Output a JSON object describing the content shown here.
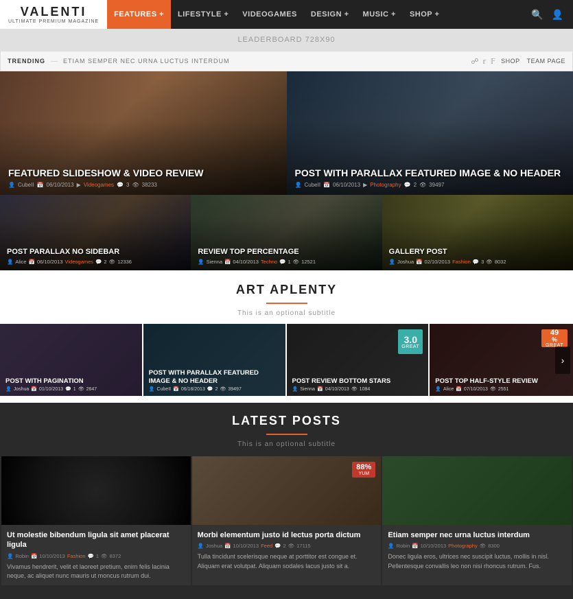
{
  "header": {
    "logo": "VALENTI",
    "logo_sub": "ULTIMATE PREMIUM MAGAZINE",
    "nav": [
      {
        "label": "FEATURES +",
        "active": true
      },
      {
        "label": "LIFESTYLE +",
        "active": false
      },
      {
        "label": "VIDEOGAMES",
        "active": false
      },
      {
        "label": "DESIGN +",
        "active": false
      },
      {
        "label": "MUSIC +",
        "active": false
      },
      {
        "label": "SHOP +",
        "active": false
      }
    ]
  },
  "leaderboard": "LEADERBOARD 728X90",
  "trending": {
    "label": "TRENDING",
    "text": "ETIAM SEMPER NEC URNA LUCTUS INTERDUM",
    "links": [
      "SHOP",
      "TEAM PAGE"
    ]
  },
  "featured": [
    {
      "title": "FEATURED SLIDESHOW & VIDEO REVIEW",
      "author": "CubeII",
      "date": "06/10/2013",
      "category": "Videogames",
      "comments": "3",
      "views": "38233"
    },
    {
      "title": "POST WITH PARALLAX FEATURED IMAGE & NO HEADER",
      "author": "CubeII",
      "date": "06/10/2013",
      "category": "Photography",
      "comments": "2",
      "views": "39497"
    }
  ],
  "small_posts": [
    {
      "title": "POST PARALLAX NO SIDEBAR",
      "author": "Alice",
      "date": "06/10/2013",
      "category": "Videogames",
      "comments": "2",
      "views": "12336"
    },
    {
      "title": "REVIEW TOP PERCENTAGE",
      "author": "Sienna",
      "date": "04/10/2013",
      "category": "Techno",
      "comments": "1",
      "views": "12521"
    },
    {
      "title": "GALLERY POST",
      "author": "Joshua",
      "date": "02/10/2013",
      "category": "Fashion",
      "comments": "3",
      "views": "8032"
    }
  ],
  "section1": {
    "title": "ART APLENTY",
    "subtitle": "This is an optional subtitle"
  },
  "carousel": [
    {
      "title": "POST WITH PAGINATION",
      "author": "Joshua",
      "date": "01/10/2013",
      "category": "",
      "comments": "1",
      "views": "2647",
      "score": null
    },
    {
      "title": "POST WITH PARALLAX FEATURED IMAGE & NO HEADER",
      "author": "CubeII",
      "date": "06/18/2013",
      "category": "",
      "comments": "2",
      "views": "39497",
      "score": null
    },
    {
      "title": "POST REVIEW BOTTOM STARS",
      "author": "Sienna",
      "date": "04/10/2013",
      "category": "",
      "comments": "",
      "views": "1084",
      "score": "3.0",
      "score_label": "GREAT"
    },
    {
      "title": "POST TOP HALF-STYLE REVIEW",
      "author": "Alice",
      "date": "07/10/2013",
      "category": "",
      "comments": "",
      "views": "2551",
      "score_pct": "49",
      "score_label": "GREAT"
    }
  ],
  "section2": {
    "title": "LATEST POSTS",
    "subtitle": "This is an optional subtitle"
  },
  "posts": [
    {
      "title": "Ut molestie bibendum ligula sit amet placerat ligula",
      "author": "Robin",
      "date": "10/10/2013",
      "category": "Fashion",
      "comments": "1",
      "views": "8372",
      "excerpt": "Vivamus hendrerit, velit et laoreet pretium, enim felis lacinia neque, ac aliquet nunc mauris ut moncus rutrum dui.",
      "score": null
    },
    {
      "title": "Morbi elementum justo id lectus porta dictum",
      "author": "Joshua",
      "date": "10/10/2013",
      "category": "Feed",
      "comments": "2",
      "views": "17115",
      "excerpt": "Tulla tincidunt scelerisque neque at porttitor est congue et. Aliquam erat volutpat. Aliquam sodales lacus justo sit a.",
      "score": "88",
      "score_label": "YUM"
    },
    {
      "title": "Etiam semper nec urna luctus interdum",
      "author": "Robin",
      "date": "10/10/2013",
      "category": "Photography",
      "comments": "",
      "views": "8300",
      "excerpt": "Donec ligula eros, ultrices nec suscipit luctus, mollis in nisl. Pellentesque convallis leo non nisi rhoncus rutrum. Fus.",
      "score": null
    }
  ]
}
